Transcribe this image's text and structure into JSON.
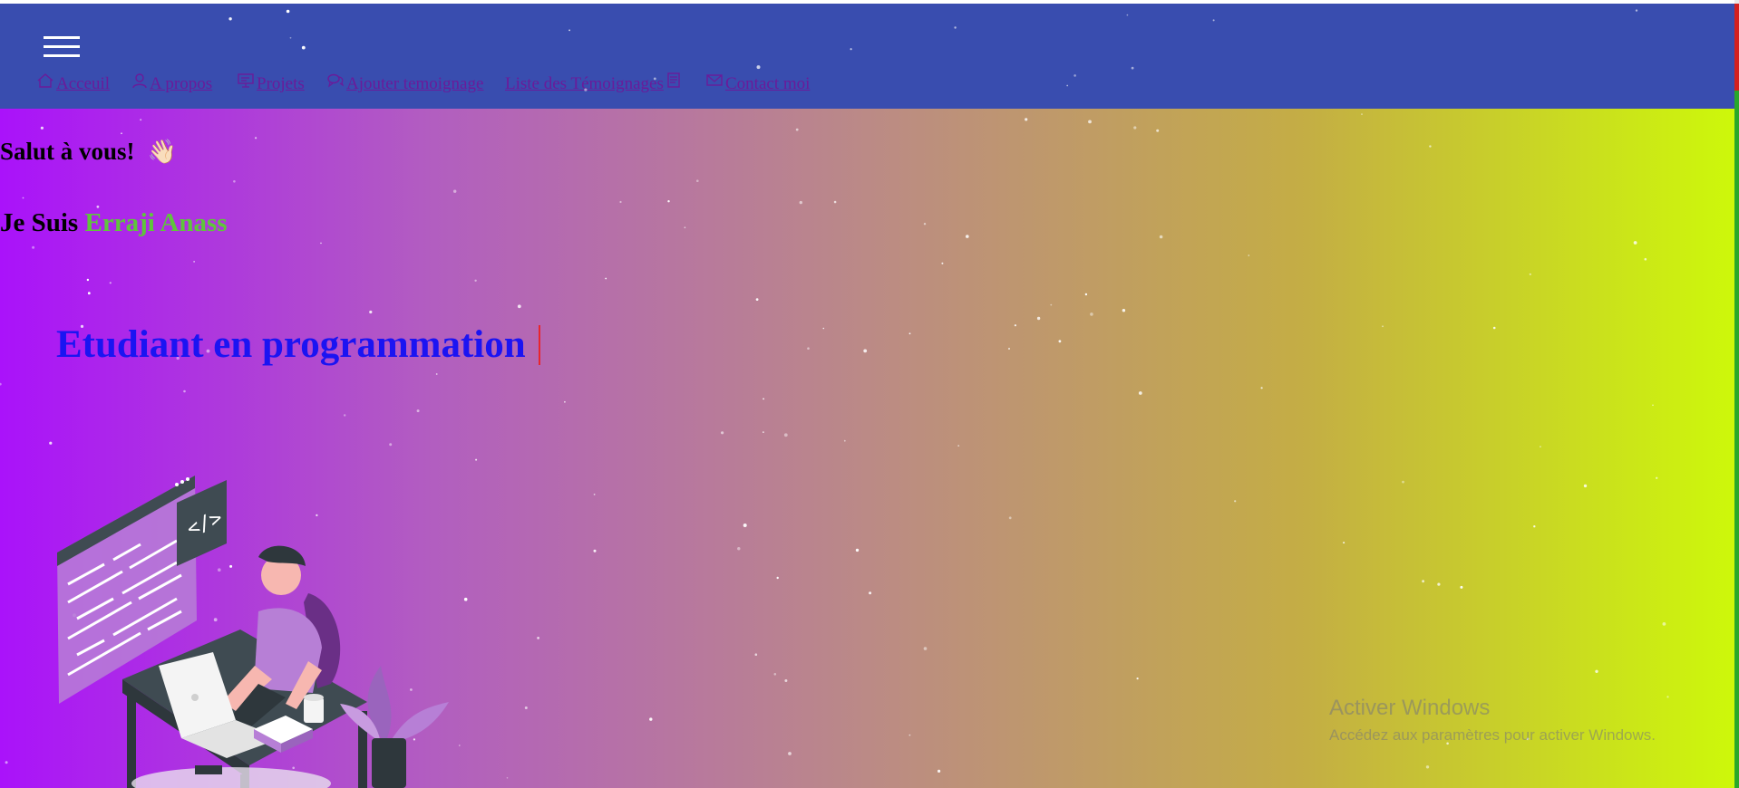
{
  "menu": {
    "icon": "hamburger-menu-icon"
  },
  "nav": {
    "items": [
      {
        "label": "Acceuil",
        "icon": "home-icon"
      },
      {
        "label": "A propos",
        "icon": "user-icon"
      },
      {
        "label": "Projets",
        "icon": "presentation-icon"
      },
      {
        "label": "Ajouter temoignage",
        "icon": "chat-bubbles-icon"
      },
      {
        "label": "Liste des Témoignages",
        "icon": "document-list-icon"
      },
      {
        "label": "Contact moi",
        "icon": "envelope-icon"
      }
    ]
  },
  "hero": {
    "greeting": "Salut à vous!",
    "greeting_emoji": "👋🏻",
    "intro_prefix": "Je Suis",
    "name": "Erraji Anass",
    "typed_title": "Etudiant en programmation"
  },
  "watermark": {
    "title": "Activer Windows",
    "subtitle": "Accédez aux paramètres pour activer Windows."
  },
  "colors": {
    "topbar": "#394daf",
    "name": "#5fc53c",
    "title": "#1b14f2",
    "caret": "#e8252e",
    "nav_link": "#6a1b9a"
  }
}
